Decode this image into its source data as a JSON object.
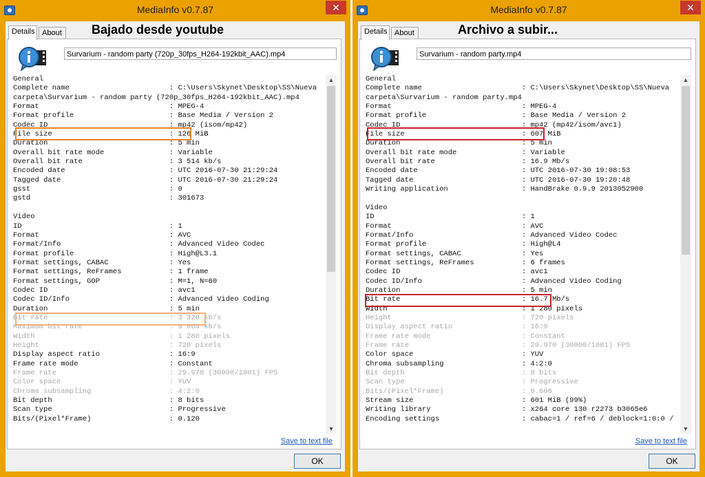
{
  "windows": [
    {
      "title": "MediaInfo v0.7.87",
      "close_label": "✕",
      "tabs": [
        {
          "label": "Details"
        },
        {
          "label": "About"
        }
      ],
      "annotation": "Bajado desde youtube",
      "filename": "Survarium - random party (720p_30fps_H264-192kbit_AAC).mp4",
      "lines": [
        {
          "text": "General",
          "dim": false
        },
        {
          "text": "Complete name                       : C:\\Users\\Skynet\\Desktop\\SS\\Nueva",
          "dim": false
        },
        {
          "text": "carpeta\\Survarium - random party (720p_30fps_H264-192kbit_AAC).mp4",
          "dim": false
        },
        {
          "text": "Format                              : MPEG-4",
          "dim": false
        },
        {
          "text": "Format profile                      : Base Media / Version 2",
          "dim": false
        },
        {
          "text": "Codec ID                            : mp42 (isom/mp42)",
          "dim": false
        },
        {
          "text": "File size                           : 126 MiB",
          "dim": false
        },
        {
          "text": "Duration                            : 5 min",
          "dim": false
        },
        {
          "text": "Overall bit rate mode               : Variable",
          "dim": false
        },
        {
          "text": "Overall bit rate                    : 3 514 kb/s",
          "dim": false
        },
        {
          "text": "Encoded date                        : UTC 2016-07-30 21:29:24",
          "dim": false
        },
        {
          "text": "Tagged date                         : UTC 2016-07-30 21:29:24",
          "dim": false
        },
        {
          "text": "gsst                                : 0",
          "dim": false
        },
        {
          "text": "gstd                                : 301673",
          "dim": false
        },
        {
          "text": "",
          "dim": false
        },
        {
          "text": "Video",
          "dim": false
        },
        {
          "text": "ID                                  : 1",
          "dim": false
        },
        {
          "text": "Format                              : AVC",
          "dim": false
        },
        {
          "text": "Format/Info                         : Advanced Video Codec",
          "dim": false
        },
        {
          "text": "Format profile                      : High@L3.1",
          "dim": false
        },
        {
          "text": "Format settings, CABAC              : Yes",
          "dim": false
        },
        {
          "text": "Format settings, ReFrames           : 1 frame",
          "dim": false
        },
        {
          "text": "Format settings, GOP                : M=1, N=60",
          "dim": false
        },
        {
          "text": "Codec ID                            : avc1",
          "dim": false
        },
        {
          "text": "Codec ID/Info                       : Advanced Video Coding",
          "dim": false
        },
        {
          "text": "Duration                            : 5 min",
          "dim": false
        },
        {
          "text": "Bit rate                            : 3 320 kb/s",
          "dim": true
        },
        {
          "text": "Maximum bit rate                    : 9 064 kb/s",
          "dim": true
        },
        {
          "text": "Width                               : 1 280 pixels",
          "dim": true
        },
        {
          "text": "Height                              : 720 pixels",
          "dim": true
        },
        {
          "text": "Display aspect ratio                : 16:9",
          "dim": false
        },
        {
          "text": "Frame rate mode                     : Constant",
          "dim": false
        },
        {
          "text": "Frame rate                          : 29.970 (30000/1001) FPS",
          "dim": true
        },
        {
          "text": "Color space                         : YUV",
          "dim": true
        },
        {
          "text": "Chroma subsampling                  : 4:2:0",
          "dim": true
        },
        {
          "text": "Bit depth                           : 8 bits",
          "dim": false
        },
        {
          "text": "Scan type                           : Progressive",
          "dim": false
        },
        {
          "text": "Bits/(Pixel*Frame)                  : 0.120",
          "dim": false
        }
      ],
      "save_link": "Save to text file",
      "ok_label": "OK",
      "highlight_color": "#e8842a"
    },
    {
      "title": "MediaInfo v0.7.87",
      "close_label": "✕",
      "tabs": [
        {
          "label": "Details"
        },
        {
          "label": "About"
        }
      ],
      "annotation": "Archivo a subir...",
      "filename": "Survarium - random party.mp4",
      "lines": [
        {
          "text": "General",
          "dim": false
        },
        {
          "text": "Complete name                       : C:\\Users\\Skynet\\Desktop\\SS\\Nueva",
          "dim": false
        },
        {
          "text": "carpeta\\Survarium - random party.mp4",
          "dim": false
        },
        {
          "text": "Format                              : MPEG-4",
          "dim": false
        },
        {
          "text": "Format profile                      : Base Media / Version 2",
          "dim": false
        },
        {
          "text": "Codec ID                            : mp42 (mp42/isom/avc1)",
          "dim": false
        },
        {
          "text": "File size                           : 607 MiB",
          "dim": false
        },
        {
          "text": "Duration                            : 5 min",
          "dim": false
        },
        {
          "text": "Overall bit rate mode               : Variable",
          "dim": false
        },
        {
          "text": "Overall bit rate                    : 16.9 Mb/s",
          "dim": false
        },
        {
          "text": "Encoded date                        : UTC 2016-07-30 19:08:53",
          "dim": false
        },
        {
          "text": "Tagged date                         : UTC 2016-07-30 19:20:48",
          "dim": false
        },
        {
          "text": "Writing application                 : HandBrake 0.9.9 2013052900",
          "dim": false
        },
        {
          "text": "",
          "dim": false
        },
        {
          "text": "Video",
          "dim": false
        },
        {
          "text": "ID                                  : 1",
          "dim": false
        },
        {
          "text": "Format                              : AVC",
          "dim": false
        },
        {
          "text": "Format/Info                         : Advanced Video Codec",
          "dim": false
        },
        {
          "text": "Format profile                      : High@L4",
          "dim": false
        },
        {
          "text": "Format settings, CABAC              : Yes",
          "dim": false
        },
        {
          "text": "Format settings, ReFrames           : 6 frames",
          "dim": false
        },
        {
          "text": "Codec ID                            : avc1",
          "dim": false
        },
        {
          "text": "Codec ID/Info                       : Advanced Video Coding",
          "dim": false
        },
        {
          "text": "Duration                            : 5 min",
          "dim": false
        },
        {
          "text": "Bit rate                            : 16.7 Mb/s",
          "dim": false
        },
        {
          "text": "Width                               : 1 280 pixels",
          "dim": false
        },
        {
          "text": "Height                              : 720 pixels",
          "dim": true
        },
        {
          "text": "Display aspect ratio                : 16:9",
          "dim": true
        },
        {
          "text": "Frame rate mode                     : Constant",
          "dim": true
        },
        {
          "text": "Frame rate                          : 29.970 (30000/1001) FPS",
          "dim": true
        },
        {
          "text": "Color space                         : YUV",
          "dim": false
        },
        {
          "text": "Chroma subsampling                  : 4:2:0",
          "dim": false
        },
        {
          "text": "Bit depth                           : 8 bits",
          "dim": true
        },
        {
          "text": "Scan type                           : Progressive",
          "dim": true
        },
        {
          "text": "Bits/(Pixel*Frame)                  : 0.606",
          "dim": true
        },
        {
          "text": "Stream size                         : 601 MiB (99%)",
          "dim": false
        },
        {
          "text": "Writing library                     : x264 core 130 r2273 b3065e6",
          "dim": false
        },
        {
          "text": "Encoding settings                   : cabac=1 / ref=6 / deblock=1:0:0 /",
          "dim": false
        }
      ],
      "save_link": "Save to text file",
      "ok_label": "OK",
      "highlight_color": "#c8232c"
    }
  ]
}
